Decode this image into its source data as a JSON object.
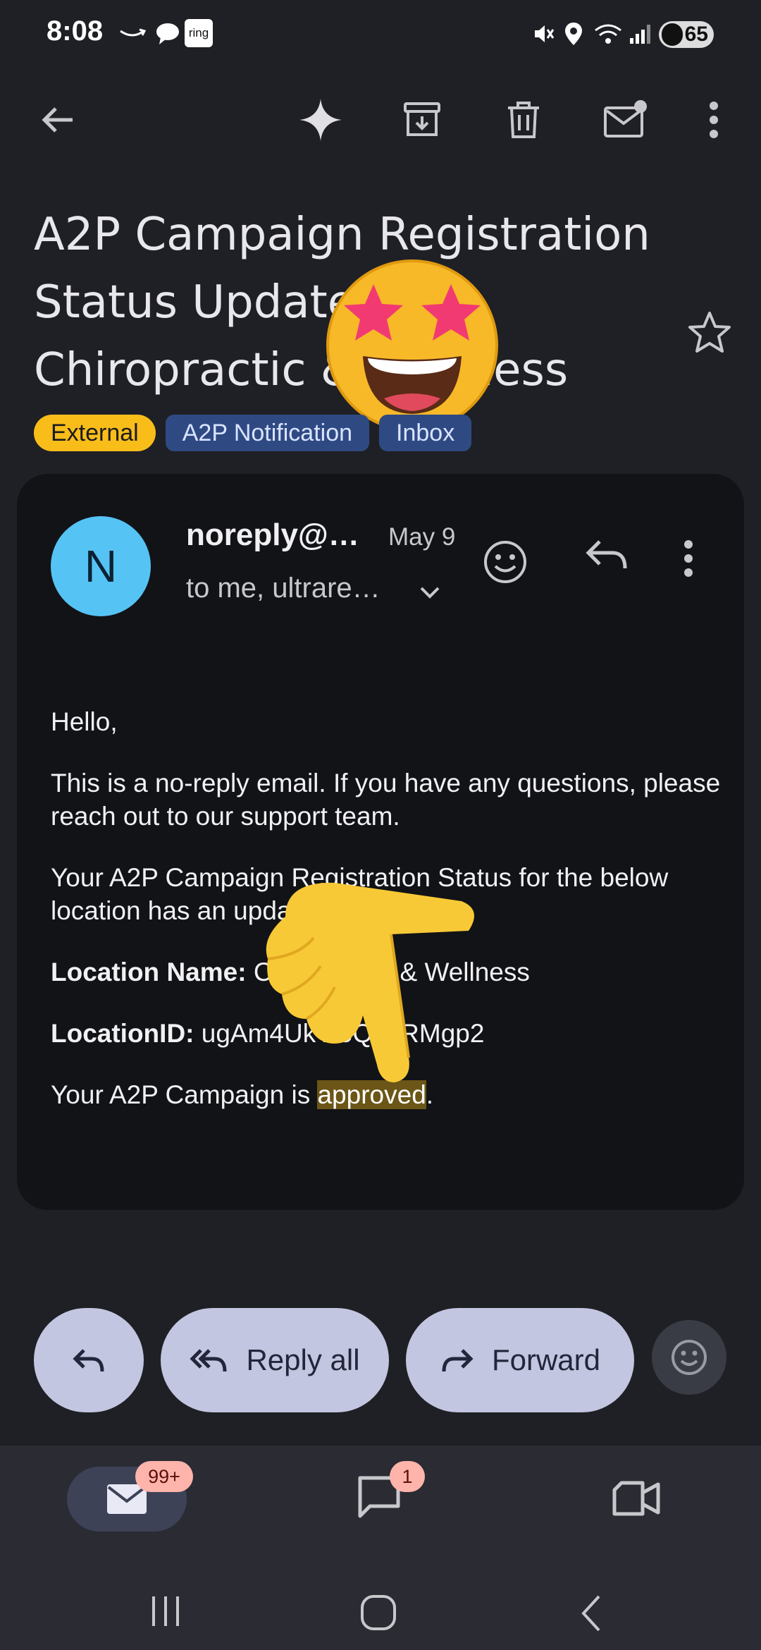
{
  "status_bar": {
    "time": "8:08",
    "ring_label": "ring",
    "battery": "65"
  },
  "subject": "A2P Campaign Registration Status Update – Chiropractic & Wellness",
  "labels": [
    "External",
    "A2P Notification",
    "Inbox"
  ],
  "message": {
    "avatar_letter": "N",
    "sender": "noreply@…",
    "date": "May 9",
    "recipients": "to me, ultrare…",
    "greeting": "Hello,",
    "para1": "This is a no-reply email. If you have any questions, please reach out to our support team.",
    "para2": "Your A2P Campaign Registration Status for the below location has an update.",
    "location_name_label": "Location Name:",
    "location_name_value": "Chiropractic & Wellness",
    "location_id_label": "LocationID:",
    "location_id_value": "ugAm4UkYi6QqcRMgp2",
    "status_prefix": "Your A2P Campaign is ",
    "status_value": "approved",
    "status_suffix": "."
  },
  "actions": {
    "reply_all": "Reply all",
    "forward": "Forward"
  },
  "bottom_nav": {
    "mail_badge": "99+",
    "chat_badge": "1"
  },
  "colors": {
    "background": "#1f2025",
    "card": "#121317",
    "external_chip": "#f9bd1a",
    "label_chip": "#2f4a83",
    "avatar": "#56c3f5",
    "action_pill": "#c3c6e0",
    "highlight": "#6b5617",
    "badge": "#ffb4ab"
  }
}
